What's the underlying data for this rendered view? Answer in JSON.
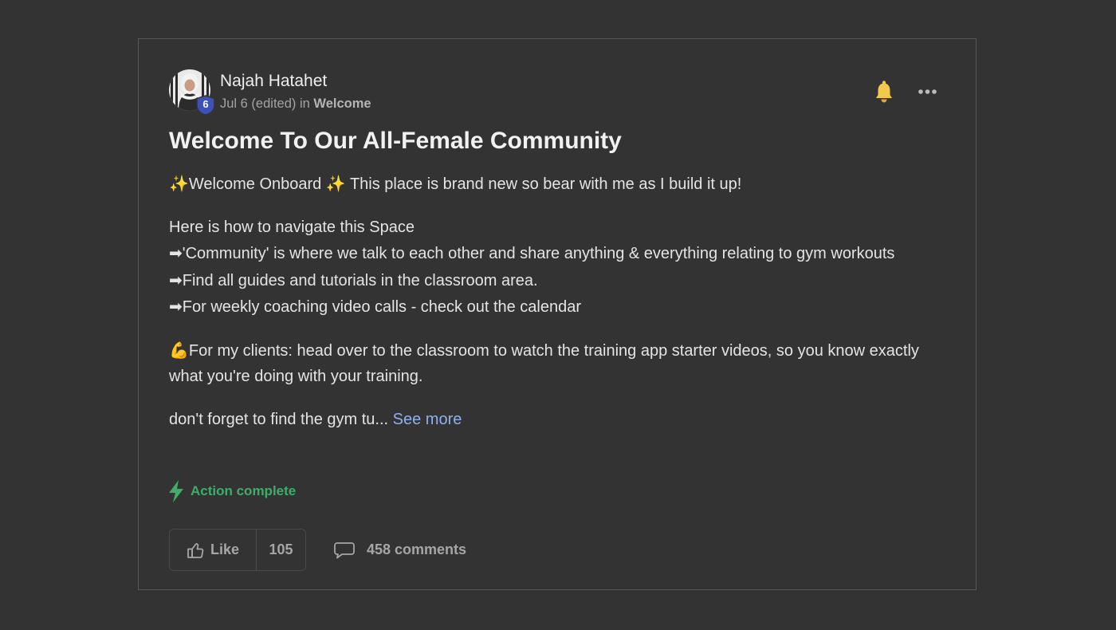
{
  "post": {
    "author": "Najah Hatahet",
    "level": "6",
    "date": "Jul 6 (edited)",
    "in_label": "in",
    "space": "Welcome",
    "title": "Welcome To Our All-Female Community",
    "paragraphs": {
      "intro": {
        "emoji_1": "✨",
        "text_1": "Welcome Onboard ",
        "emoji_2": "✨",
        "text_2": " This place is brand new so bear with me as I build it up!"
      },
      "navigate": {
        "heading": "Here is how to navigate this Space",
        "items": [
          {
            "icon": "➡",
            "text": "'Community' is where we talk to each other and share anything & everything relating to gym workouts"
          },
          {
            "icon": "➡",
            "text": "Find all guides and tutorials in the classroom area."
          },
          {
            "icon": "➡",
            "text": "For weekly coaching video calls - check out the calendar"
          }
        ]
      },
      "clients": {
        "emoji": "💪",
        "text": "For my clients: head over to the classroom to watch the training app starter videos, so you know exactly what you're doing with your training."
      },
      "truncated": {
        "text": "don't forget to find the gym tu... ",
        "see_more": "See more"
      }
    },
    "action_label": "Action complete",
    "like_label": "Like",
    "like_count": "105",
    "comments_label": "458 comments"
  },
  "colors": {
    "background": "#333333",
    "card_border": "#575757",
    "link_blue": "#8fb0ee",
    "action_green": "#3fad68",
    "bell_yellow": "#f2c94c",
    "badge_blue": "#3d52b8"
  },
  "icons": {
    "bell": "bell-icon",
    "more": "more-icon",
    "lightning": "lightning-icon",
    "thumbs_up": "thumbs-up-icon",
    "comment": "comment-icon"
  }
}
